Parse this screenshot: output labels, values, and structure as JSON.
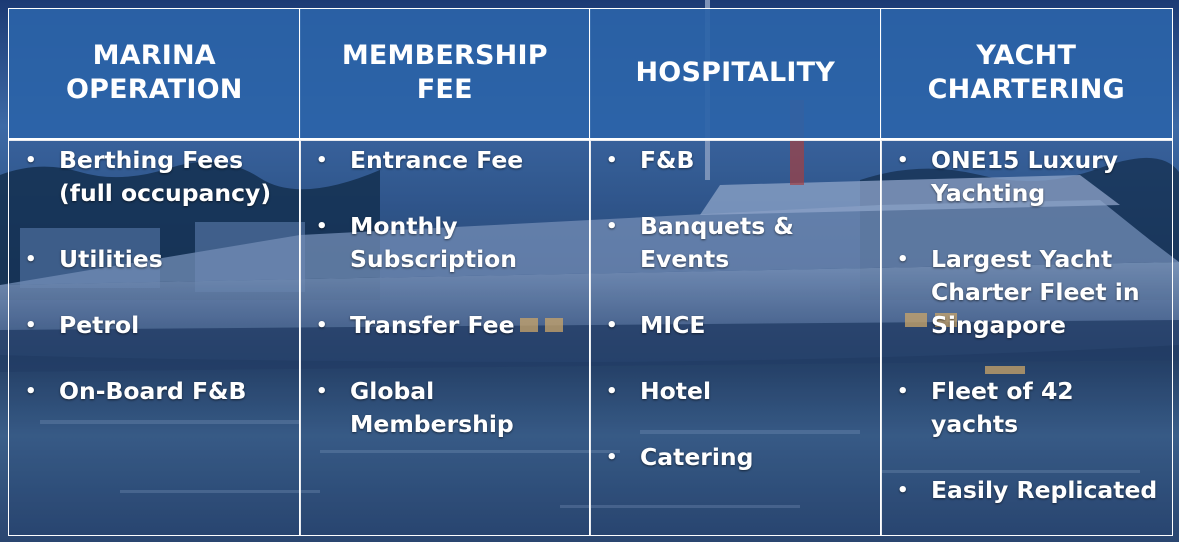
{
  "colors": {
    "header_fill": "#2b63a8",
    "grid_line": "#ffffff",
    "text": "#ffffff"
  },
  "columns": [
    {
      "header": "MARINA OPERATION",
      "header_lines": [
        "MARINA",
        "OPERATION"
      ],
      "items": [
        "Berthing Fees (full occupancy)",
        "Utilities",
        "Petrol",
        "On-Board F&B"
      ]
    },
    {
      "header": "MEMBERSHIP FEE",
      "header_lines": [
        "MEMBERSHIP",
        "FEE"
      ],
      "items": [
        "Entrance Fee",
        "Monthly Subscription",
        "Transfer Fee",
        "Global Membership"
      ]
    },
    {
      "header": "HOSPITALITY",
      "header_lines": [
        "HOSPITALITY"
      ],
      "items": [
        "F&B",
        "Banquets & Events",
        "MICE",
        "Hotel",
        "Catering"
      ]
    },
    {
      "header": "YACHT CHARTERING",
      "header_lines": [
        "YACHT",
        "CHARTERING"
      ],
      "items": [
        "ONE15 Luxury Yachting",
        "Largest Yacht Charter Fleet in Singapore",
        "Fleet of 42 yachts",
        "Easily Replicated"
      ]
    }
  ]
}
